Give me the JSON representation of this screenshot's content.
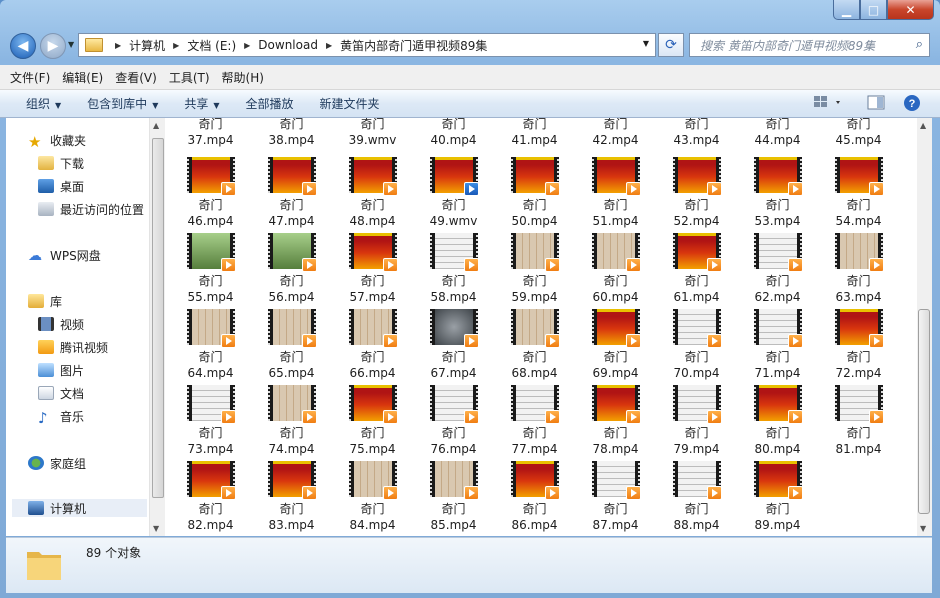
{
  "window": {
    "min_label": "▁",
    "max_label": "□",
    "close_label": "✕"
  },
  "address": {
    "crumbs": [
      "计算机",
      "文档 (E:)",
      "Download",
      "黄笛内部奇门遁甲视频89集"
    ]
  },
  "search": {
    "placeholder": "搜索 黄笛内部奇门遁甲视频89集"
  },
  "menu": [
    "文件(F)",
    "编辑(E)",
    "查看(V)",
    "工具(T)",
    "帮助(H)"
  ],
  "commands": {
    "organize": "组织",
    "include_library": "包含到库中",
    "share": "共享",
    "play_all": "全部播放",
    "new_folder": "新建文件夹"
  },
  "sidebar": {
    "favorites": "收藏夹",
    "downloads": "下载",
    "desktop": "桌面",
    "recent": "最近访问的位置",
    "wps": "WPS网盘",
    "libraries": "库",
    "videos": "视频",
    "tencent_video": "腾讯视频",
    "pictures": "图片",
    "documents": "文档",
    "music": "音乐",
    "homegroup": "家庭组",
    "computer": "计算机"
  },
  "files": {
    "top_row": [
      "37.mp4",
      "38.mp4",
      "39.wmv",
      "40.mp4",
      "41.mp4",
      "42.mp4",
      "43.mp4",
      "44.mp4",
      "45.mp4"
    ],
    "rows": [
      [
        "46.mp4",
        "47.mp4",
        "48.mp4",
        "49.wmv",
        "50.mp4",
        "51.mp4",
        "52.mp4",
        "53.mp4",
        "54.mp4"
      ],
      [
        "55.mp4",
        "56.mp4",
        "57.mp4",
        "58.mp4",
        "59.mp4",
        "60.mp4",
        "61.mp4",
        "62.mp4",
        "63.mp4"
      ],
      [
        "64.mp4",
        "65.mp4",
        "66.mp4",
        "67.mp4",
        "68.mp4",
        "69.mp4",
        "70.mp4",
        "71.mp4",
        "72.mp4"
      ],
      [
        "73.mp4",
        "74.mp4",
        "75.mp4",
        "76.mp4",
        "77.mp4",
        "78.mp4",
        "79.mp4",
        "80.mp4",
        "81.mp4"
      ],
      [
        "82.mp4",
        "83.mp4",
        "84.mp4",
        "85.mp4",
        "86.mp4",
        "87.mp4",
        "88.mp4",
        "89.mp4"
      ]
    ],
    "name_prefix": "奇门"
  },
  "status": {
    "count_text": "89 个对象"
  }
}
